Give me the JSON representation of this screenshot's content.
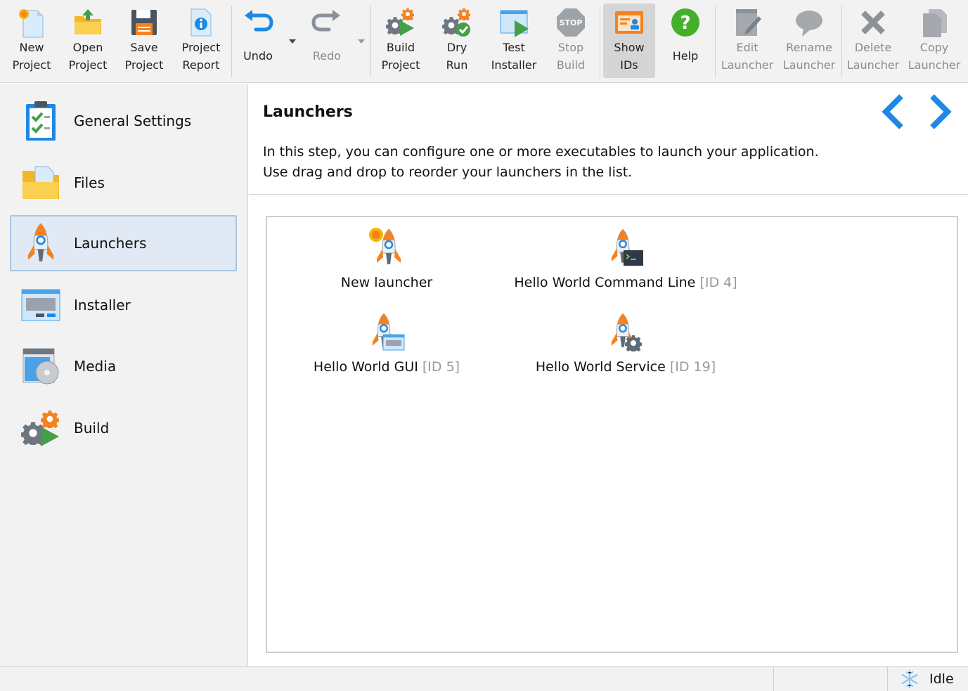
{
  "toolbar": {
    "new_project": "New\nProject",
    "open_project": "Open\nProject",
    "save_project": "Save\nProject",
    "project_report": "Project\nReport",
    "undo": "Undo",
    "redo": "Redo",
    "build_project": "Build\nProject",
    "dry_run": "Dry\nRun",
    "test_installer": "Test\nInstaller",
    "stop_build": "Stop\nBuild",
    "show_ids": "Show\nIDs",
    "help": "Help",
    "edit_launcher": "Edit\nLauncher",
    "rename_launcher": "Rename\nLauncher",
    "delete_launcher": "Delete\nLauncher",
    "copy_launcher": "Copy\nLauncher"
  },
  "sidebar": {
    "items": [
      {
        "label": "General Settings",
        "icon": "clipboard-check-icon"
      },
      {
        "label": "Files",
        "icon": "folder-icon"
      },
      {
        "label": "Launchers",
        "icon": "rocket-icon",
        "selected": true
      },
      {
        "label": "Installer",
        "icon": "installer-window-icon"
      },
      {
        "label": "Media",
        "icon": "media-disc-icon"
      },
      {
        "label": "Build",
        "icon": "build-gears-icon"
      }
    ]
  },
  "main": {
    "title": "Launchers",
    "description": "In this step, you can configure one or more executables to launch your application. Use drag and drop to reorder your launchers in the list.",
    "launchers": [
      {
        "name": "New launcher",
        "id": ""
      },
      {
        "name": "Hello World Command Line",
        "id": "[ID 4]"
      },
      {
        "name": "Hello World GUI",
        "id": "[ID 5]"
      },
      {
        "name": "Hello World Service",
        "id": "[ID 19]"
      }
    ]
  },
  "status": {
    "text": "Idle",
    "icon": "snowflake-icon"
  },
  "colors": {
    "accent_blue": "#1e88e5",
    "rocket_orange": "#f58220",
    "selection_bg": "#e1eaf4",
    "disabled_text": "#8a8a8a"
  }
}
